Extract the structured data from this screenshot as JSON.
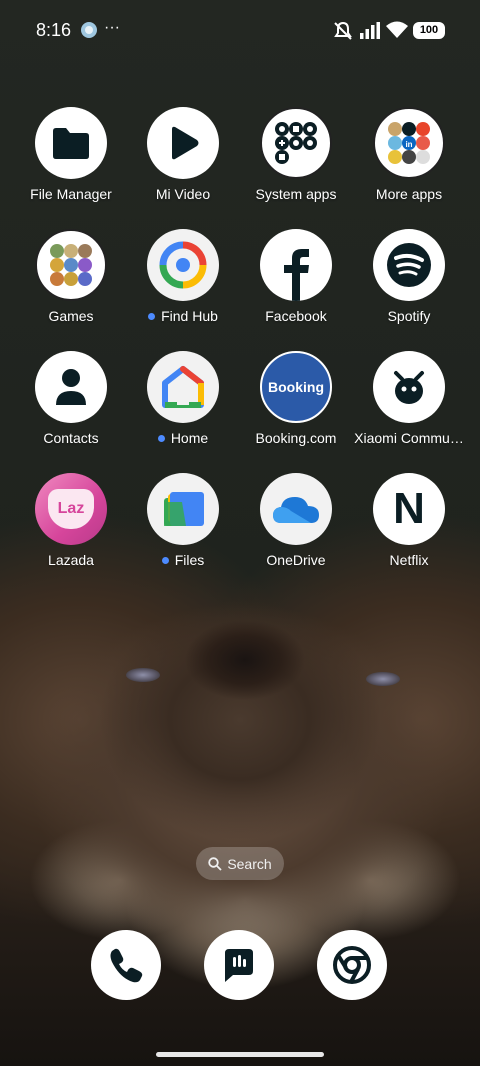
{
  "status_bar": {
    "time": "8:16",
    "more": "···",
    "battery": "100",
    "icons": [
      "app-notification-icon",
      "mute-icon",
      "signal-icon",
      "wifi-icon",
      "battery-icon"
    ]
  },
  "apps": [
    {
      "label": "File Manager",
      "icon": "folder-icon",
      "dot": false
    },
    {
      "label": "Mi Video",
      "icon": "play-icon",
      "dot": false
    },
    {
      "label": "System apps",
      "icon": "folder-group-icon",
      "dot": false
    },
    {
      "label": "More apps",
      "icon": "folder-group-icon",
      "dot": false
    },
    {
      "label": "Games",
      "icon": "folder-group-icon",
      "dot": false
    },
    {
      "label": "Find Hub",
      "icon": "find-hub-icon",
      "dot": true
    },
    {
      "label": "Facebook",
      "icon": "facebook-icon",
      "dot": false
    },
    {
      "label": "Spotify",
      "icon": "spotify-icon",
      "dot": false
    },
    {
      "label": "Contacts",
      "icon": "person-icon",
      "dot": false
    },
    {
      "label": "Home",
      "icon": "google-home-icon",
      "dot": true
    },
    {
      "label": "Booking.com",
      "icon": "booking-icon",
      "dot": false,
      "icon_text": "Booking"
    },
    {
      "label": "Xiaomi Commu…",
      "icon": "xiaomi-community-icon",
      "dot": false
    },
    {
      "label": "Lazada",
      "icon": "lazada-icon",
      "dot": false,
      "icon_text": "Laz"
    },
    {
      "label": "Files",
      "icon": "files-icon",
      "dot": true
    },
    {
      "label": "OneDrive",
      "icon": "cloud-icon",
      "dot": false
    },
    {
      "label": "Netflix",
      "icon": "netflix-icon",
      "dot": false,
      "icon_text": "N"
    }
  ],
  "search": {
    "label": "Search"
  },
  "dock": [
    {
      "name": "phone",
      "icon": "phone-icon"
    },
    {
      "name": "messages",
      "icon": "message-icon"
    },
    {
      "name": "chrome",
      "icon": "chrome-icon"
    }
  ],
  "colors": {
    "background": "#1e211c",
    "notification_dot": "#4d8bff",
    "booking_blue": "#2b5aa8",
    "lazada_pink": "#d6459b"
  }
}
